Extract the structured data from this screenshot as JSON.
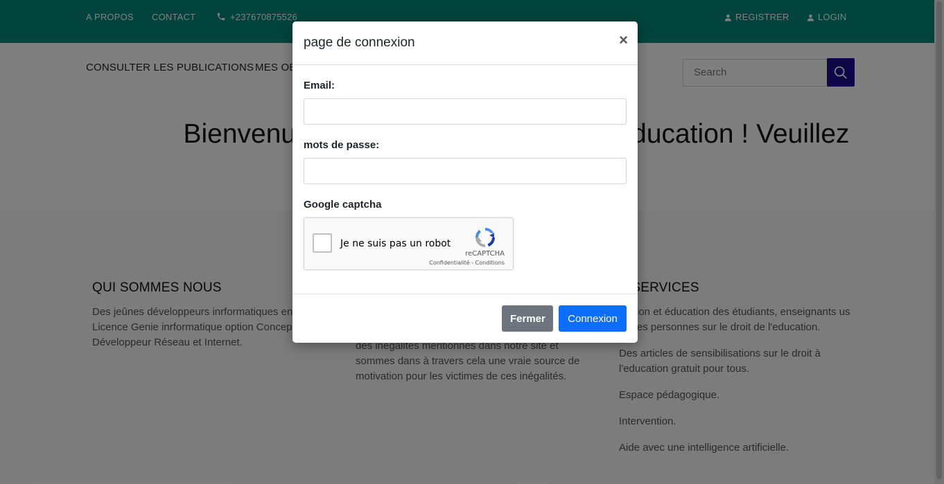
{
  "topbar": {
    "about": "A PROPOS",
    "contact": "CONTACT",
    "phone": "+237670875526",
    "register": "REGISTRER",
    "login": "LOGIN",
    "color": "#00897b"
  },
  "navbar": {
    "publications": "CONSULTER LES PUBLICATIONS",
    "works_partial": "MES OEUVRES",
    "search_placeholder": "Search"
  },
  "hero": {
    "left_text": "Bienvenu",
    "right_text": "ducation ! Veuillez"
  },
  "sections": {
    "about": {
      "title": "QUI SOMMES NOUS",
      "text": "Des jeûnes développeurs inrformatiques en Licence Genie inrformatique option Concep Développeur Réseau et Internet."
    },
    "middle": {
      "text": "des inégalités mentionnés dans notre site et sommes dans à travers cela une vraie source de motivation pour les victimes de ces inégalités."
    },
    "services": {
      "title": "S SERVICES",
      "items": [
        "mation et éducation des étudiants, enseignants us autres personnes sur le droit de l'education.",
        "Des articles de sensibilisations sur le droit à l'education gratuit pour tous.",
        "Espace pédagogique.",
        "Intervention.",
        "Aide avec une intelligence artificielle."
      ]
    }
  },
  "modal": {
    "title": "page de connexion",
    "close_symbol": "×",
    "email_label": "Email:",
    "email_value": "",
    "password_label": "mots de passe:",
    "password_value": "",
    "captcha_label": "Google captcha",
    "captcha": {
      "text": "Je ne suis pas un robot",
      "brand": "reCAPTCHA",
      "links": "Confidentialité - Conditions"
    },
    "close_button": "Fermer",
    "login_button": "Connexion"
  },
  "icons": {
    "phone": "phone-icon",
    "user": "user-icon",
    "search": "search-icon",
    "recaptcha": "recaptcha-icon"
  },
  "colors": {
    "primary": "#0d6efd",
    "secondary": "#6c757d",
    "search_button": "#1a0f8f"
  }
}
